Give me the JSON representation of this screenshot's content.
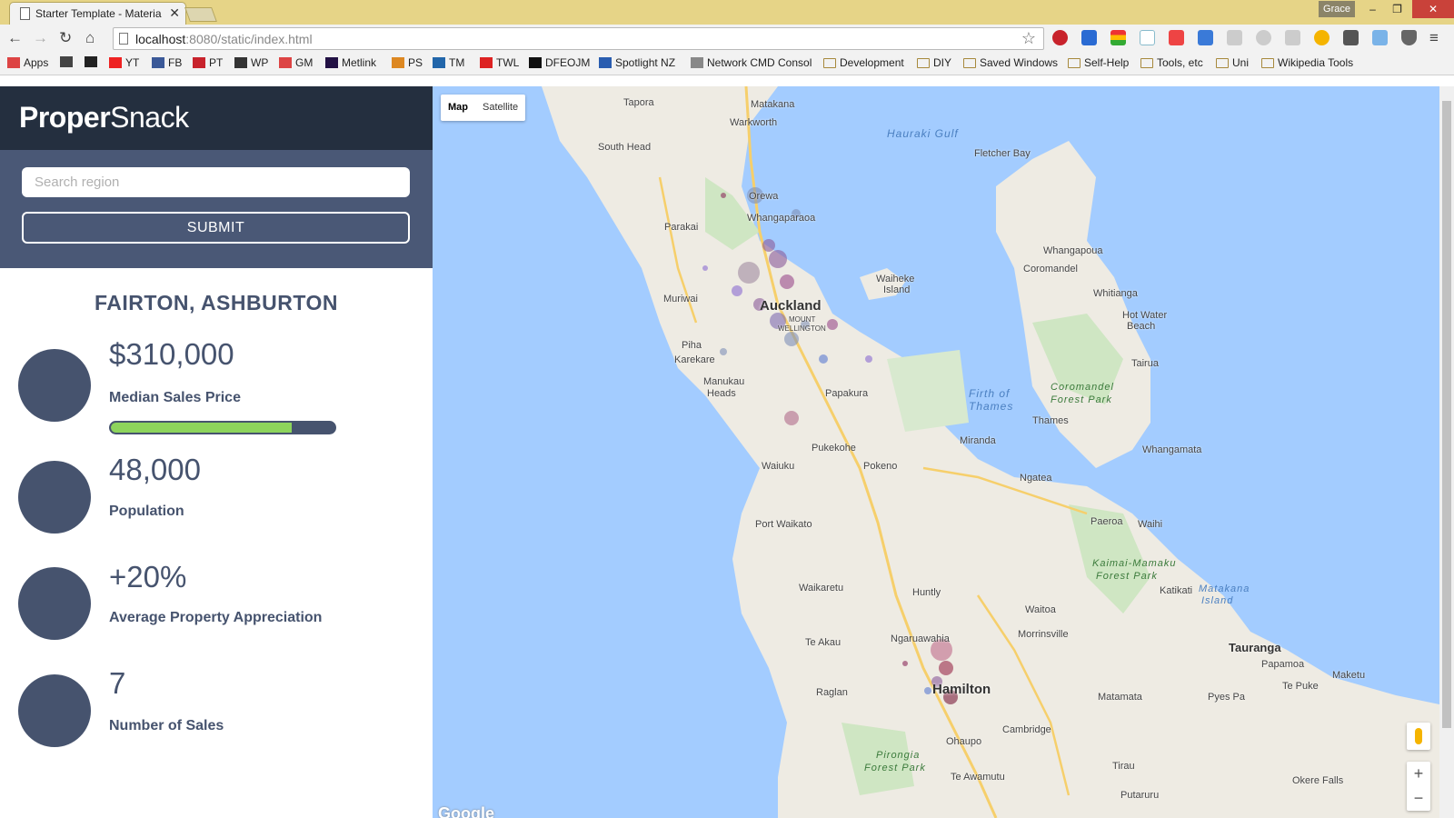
{
  "browser": {
    "tab_title": "Starter Template - Materia",
    "tab_close": "✕",
    "user_name": "Grace",
    "url_host": "localhost",
    "url_rest": ":8080/static/index.html",
    "bookmarks": [
      {
        "label": "Apps",
        "color": "#d44"
      },
      {
        "label": "",
        "color": "#444"
      },
      {
        "label": "",
        "color": "#222"
      },
      {
        "label": "YT",
        "color": "#e22"
      },
      {
        "label": "FB",
        "color": "#3b5998"
      },
      {
        "label": "PT",
        "color": "#c8232c"
      },
      {
        "label": "WP",
        "color": "#333"
      },
      {
        "label": "GM",
        "color": "#d44"
      },
      {
        "label": "Metlink",
        "color": "#214"
      },
      {
        "label": "PS",
        "color": "#d82"
      },
      {
        "label": "TM",
        "color": "#26a"
      },
      {
        "label": "TWL",
        "color": "#d22"
      },
      {
        "label": "DFEOJM",
        "color": "#111"
      },
      {
        "label": "Spotlight NZ",
        "color": "#2a5db0"
      },
      {
        "label": "Network CMD Consol",
        "color": "#888"
      },
      {
        "label": "Development",
        "color": "folder"
      },
      {
        "label": "DIY",
        "color": "folder"
      },
      {
        "label": "Saved Windows",
        "color": "folder"
      },
      {
        "label": "Self-Help",
        "color": "folder"
      },
      {
        "label": "Tools, etc",
        "color": "folder"
      },
      {
        "label": "Uni",
        "color": "folder"
      },
      {
        "label": "Wikipedia Tools",
        "color": "folder"
      }
    ]
  },
  "app": {
    "brand_bold": "Proper",
    "brand_light": "Snack",
    "search_placeholder": "Search region",
    "submit_label": "SUBMIT",
    "region_title": "FAIRTON, ASHBURTON",
    "stats": {
      "median_price": {
        "value": "$310,000",
        "label": "Median Sales Price",
        "progress": 0.81
      },
      "population": {
        "value": "48,000",
        "label": "Population"
      },
      "appreciation": {
        "value": "+20%",
        "label": "Average Property Appreciation"
      },
      "sales": {
        "value": "7",
        "label": "Number of Sales"
      }
    }
  },
  "map": {
    "type_map": "Map",
    "type_satellite": "Satellite",
    "zoom_in": "+",
    "zoom_out": "−",
    "logo": "Google",
    "labels": {
      "hauraki_gulf": "Hauraki Gulf",
      "firth": "Firth of",
      "firth2": "Thames",
      "auckland": "Auckland",
      "hamilton": "Hamilton",
      "tauranga": "Tauranga",
      "tapora": "Tapora",
      "matakana": "Matakana",
      "warkworth": "Warkworth",
      "south_head": "South Head",
      "orewa": "Orewa",
      "whangaparaoa": "Whangaparaoa",
      "parakai": "Parakai",
      "muriwai": "Muriwai",
      "piha": "Piha",
      "karekare": "Karekare",
      "manukau_heads": "Manukau",
      "manukau_heads2": "Heads",
      "papakura": "Papakura",
      "pukekohe": "Pukekohe",
      "waiuku": "Waiuku",
      "pokeno": "Pokeno",
      "port_waikato": "Port Waikato",
      "waikaretu": "Waikaretu",
      "huntly": "Huntly",
      "te_akau": "Te Akau",
      "ngaruawahia": "Ngaruawahia",
      "raglan": "Raglan",
      "fletcher_bay": "Fletcher Bay",
      "whangapoua": "Whangapoua",
      "coromandel": "Coromandel",
      "whitianga": "Whitianga",
      "hot_water_beach": "Hot Water",
      "hot_water_beach2": "Beach",
      "tairua": "Tairua",
      "thames": "Thames",
      "miranda": "Miranda",
      "ngatea": "Ngatea",
      "paeroa": "Paeroa",
      "waihi": "Waihi",
      "whangamata": "Whangamata",
      "katikati": "Katikati",
      "matakana_island": "Matakana",
      "matakana_island2": "Island",
      "waitoa": "Waitoa",
      "morrinsville": "Morrinsville",
      "matamata": "Matamata",
      "cambridge": "Cambridge",
      "ohaupo": "Ohaupo",
      "te_awamutu": "Te Awamutu",
      "tirau": "Tirau",
      "putaruru": "Putaruru",
      "papamoa": "Papamoa",
      "te_puke": "Te Puke",
      "maketu": "Maketu",
      "pyes_pa": "Pyes Pa",
      "okere_falls": "Okere Falls",
      "waiheke": "Waiheke",
      "waiheke2": "Island",
      "coromandel_fp": "Coromandel",
      "coromandel_fp2": "Forest Park",
      "kaimai": "Kaimai-Mamaku",
      "kaimai2": "Forest Park",
      "pirongia": "Pirongia",
      "pirongia2": "Forest Park",
      "mount_wellington": "MOUNT",
      "mount_wellington2": "WELLINGTON"
    }
  }
}
